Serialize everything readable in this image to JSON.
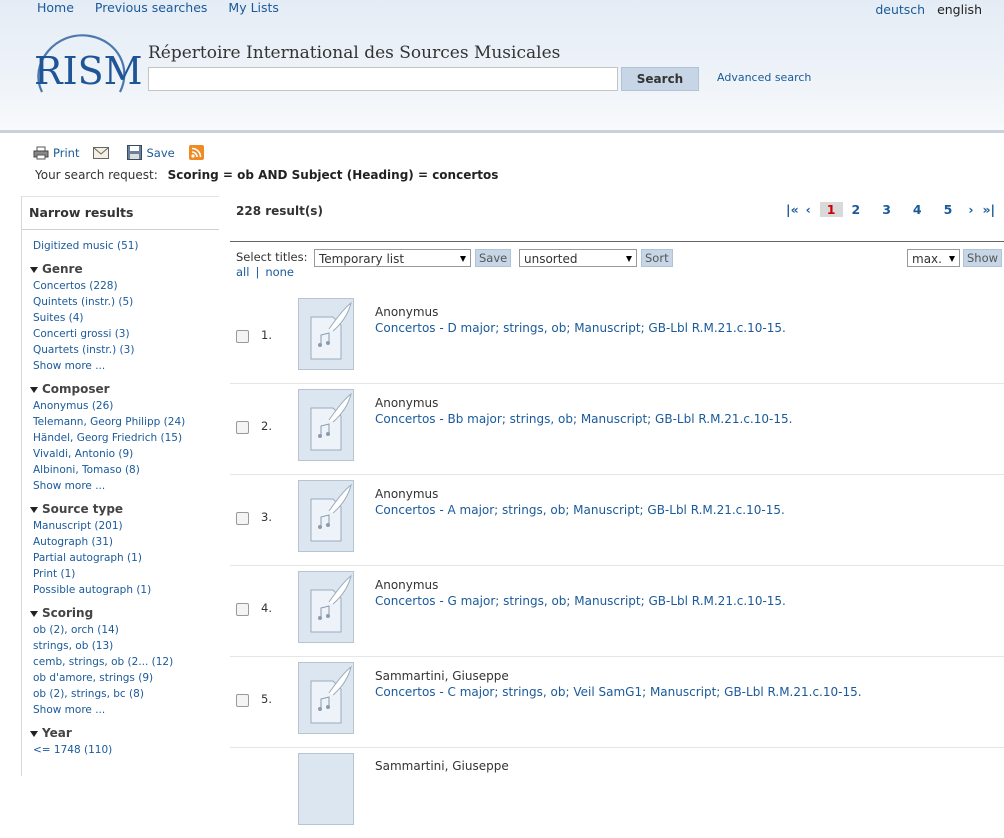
{
  "topnav": {
    "home": "Home",
    "previous": "Previous searches",
    "lists": "My Lists"
  },
  "lang": {
    "de": "deutsch",
    "en": "english"
  },
  "site_title": "Répertoire International des Sources Musicales",
  "search": {
    "value": "",
    "button": "Search",
    "advanced": "Advanced search"
  },
  "logo_text": "RISM",
  "toolbar": {
    "print": "Print",
    "save": "Save"
  },
  "request": {
    "label": "Your search request:",
    "query": "Scoring = ob AND Subject (Heading) = concertos"
  },
  "sidebar": {
    "header": "Narrow results",
    "digitized": "Digitized music (51)",
    "facets": [
      {
        "title": "Genre",
        "items": [
          "Concertos (228)",
          "Quintets (instr.) (5)",
          "Suites (4)",
          "Concerti grossi (3)",
          "Quartets (instr.) (3)",
          "Show more ..."
        ]
      },
      {
        "title": "Composer",
        "items": [
          "Anonymus (26)",
          "Telemann, Georg Philipp (24)",
          "Händel, Georg Friedrich (15)",
          "Vivaldi, Antonio (9)",
          "Albinoni, Tomaso (8)",
          "Show more ..."
        ]
      },
      {
        "title": "Source type",
        "items": [
          "Manuscript (201)",
          "Autograph (31)",
          "Partial autograph (1)",
          "Print (1)",
          "Possible autograph (1)"
        ]
      },
      {
        "title": "Scoring",
        "items": [
          "ob (2), orch (14)",
          "strings, ob (13)",
          "cemb, strings, ob (2... (12)",
          "ob d'amore, strings (9)",
          "ob (2), strings, bc (8)",
          "Show more ..."
        ]
      },
      {
        "title": "Year",
        "items": [
          "<= 1748 (110)"
        ]
      }
    ]
  },
  "results": {
    "count": "228 result(s)",
    "pager": {
      "first": "|«",
      "prev": "‹",
      "current": "1",
      "pages": [
        "2",
        "3",
        "4",
        "5"
      ],
      "next": "›",
      "last": "»|"
    },
    "select_label": "Select titles:",
    "select_all": "all",
    "select_none": "none",
    "list_dropdown": "Temporary list",
    "save_btn": "Save",
    "sort_dropdown": "unsorted",
    "sort_btn": "Sort",
    "max_dropdown": "max.",
    "show_btn": "Show",
    "items": [
      {
        "num": "1.",
        "author": "Anonymus",
        "title": "Concertos - D major; strings, ob; Manuscript; GB-Lbl R.M.21.c.10-15."
      },
      {
        "num": "2.",
        "author": "Anonymus",
        "title": "Concertos - Bb major; strings, ob; Manuscript; GB-Lbl R.M.21.c.10-15."
      },
      {
        "num": "3.",
        "author": "Anonymus",
        "title": "Concertos - A major; strings, ob; Manuscript; GB-Lbl R.M.21.c.10-15."
      },
      {
        "num": "4.",
        "author": "Anonymus",
        "title": "Concertos - G major; strings, ob; Manuscript; GB-Lbl R.M.21.c.10-15."
      },
      {
        "num": "5.",
        "author": "Sammartini, Giuseppe",
        "title": "Concertos - C major; strings, ob; Veil SamG1; Manuscript; GB-Lbl R.M.21.c.10-15."
      },
      {
        "num": "",
        "author": "Sammartini, Giuseppe",
        "title": ""
      }
    ]
  }
}
